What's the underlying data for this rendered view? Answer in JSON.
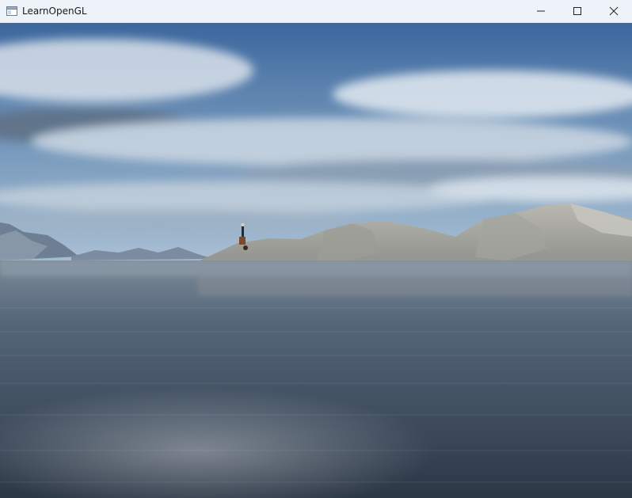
{
  "window": {
    "title": "LearnOpenGL",
    "app_icon": "window-app-icon",
    "controls": [
      "minimize-icon",
      "maximize-icon",
      "close-icon"
    ]
  },
  "scene": {
    "description_hidden": "",
    "colors": {
      "sky_top": "#3f6fa8",
      "sky_mid": "#8aa9c6",
      "cloud": "#dfe7ee",
      "mountain": "#a8a8a2",
      "far_mountain": "#6f8197",
      "water_top": "#6c7d8f",
      "water_bottom": "#2b3645"
    }
  }
}
